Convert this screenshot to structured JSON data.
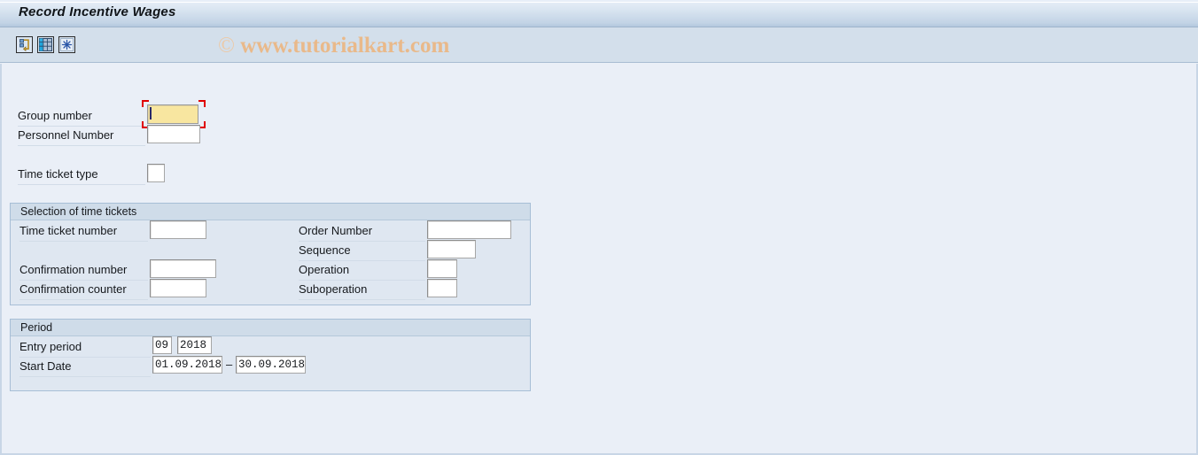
{
  "window": {
    "title": "Record Incentive Wages"
  },
  "toolbar": {
    "buttons": [
      {
        "name": "back-icon",
        "tooltip": "Back"
      },
      {
        "name": "table-icon",
        "tooltip": "Multiple Selection"
      },
      {
        "name": "execute-icon",
        "tooltip": "Execute"
      }
    ]
  },
  "watermark": {
    "symbol": "©",
    "text": "www.tutorialkart.com"
  },
  "header_fields": [
    {
      "label": "Group number",
      "value": "",
      "placeholder": ""
    },
    {
      "label": "Personnel Number",
      "value": "",
      "placeholder": ""
    },
    {
      "label": "Time ticket type",
      "value": "",
      "placeholder": ""
    }
  ],
  "selection_group": {
    "title": "Selection of time tickets",
    "left_fields": [
      {
        "label": "Time ticket number",
        "value": ""
      },
      {
        "label": "Confirmation number",
        "value": ""
      },
      {
        "label": "Confirmation counter",
        "value": ""
      }
    ],
    "right_fields": [
      {
        "label": "Order Number",
        "value": ""
      },
      {
        "label": "Sequence",
        "value": ""
      },
      {
        "label": "Operation",
        "value": ""
      },
      {
        "label": "Suboperation",
        "value": ""
      }
    ]
  },
  "period_group": {
    "title": "Period",
    "entry_period": {
      "label": "Entry period",
      "period": "09",
      "year": "2018"
    },
    "start_date": {
      "label": "Start Date",
      "from": "01.09.2018",
      "separator": "–",
      "to": "30.09.2018"
    }
  },
  "colors": {
    "title_bar": "#c3d4e6",
    "toolbar": "#d3dfeb",
    "canvas": "#eaeff7",
    "group_body": "#dfe7f1",
    "group_head": "#cfdce9",
    "focus_field": "#f8e6a0",
    "focus_marker": "#e00000",
    "watermark": "#e9b98a"
  }
}
